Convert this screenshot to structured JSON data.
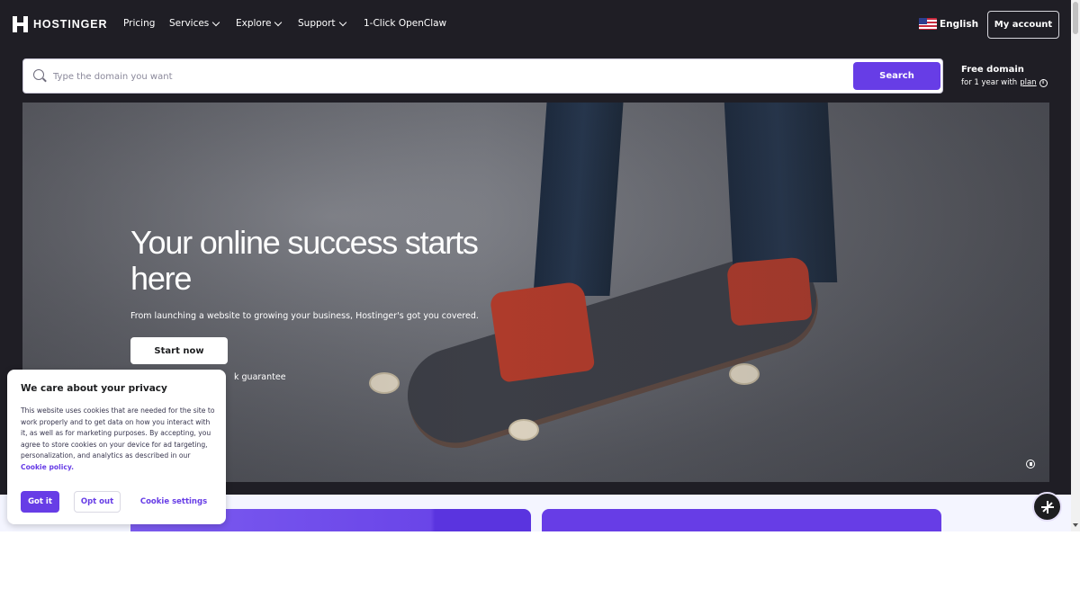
{
  "nav": {
    "brand": "HOSTINGER",
    "items": [
      {
        "label": "Pricing",
        "has_chevron": false
      },
      {
        "label": "Services",
        "has_chevron": true
      },
      {
        "label": "Explore",
        "has_chevron": true
      },
      {
        "label": "Support",
        "has_chevron": true
      },
      {
        "label": "1-Click OpenClaw",
        "has_chevron": false
      }
    ],
    "language": "English",
    "account_label": "My account"
  },
  "search": {
    "placeholder": "Type the domain you want",
    "value": "",
    "button_label": "Search"
  },
  "free_domain": {
    "title": "Free domain",
    "line_prefix": "for 1 year with",
    "line_link": "plan"
  },
  "hero": {
    "title": "Your online success starts here",
    "subtitle": "From launching a website to growing your business, Hostinger's got you covered.",
    "cta_label": "Start now",
    "guarantee_partial": "k guarantee"
  },
  "cookie": {
    "title": "We care about your privacy",
    "body": "This website uses cookies that are needed for the site to work properly and to get data on how you interact with it, as well as for marketing purposes. By accepting, you agree to store cookies on your device for ad targeting, personalization, and analytics as described in our",
    "policy_link": "Cookie policy.",
    "accept_label": "Got it",
    "optout_label": "Opt out",
    "settings_label": "Cookie settings"
  },
  "colors": {
    "brand_purple": "#673de6",
    "dark_bg": "#1f1e25",
    "white": "#ffffff"
  },
  "icons": [
    "hostinger-logo-icon",
    "chevron-down-icon",
    "us-flag-icon",
    "search-icon",
    "info-icon",
    "pause-icon",
    "ai-assistant-icon"
  ]
}
